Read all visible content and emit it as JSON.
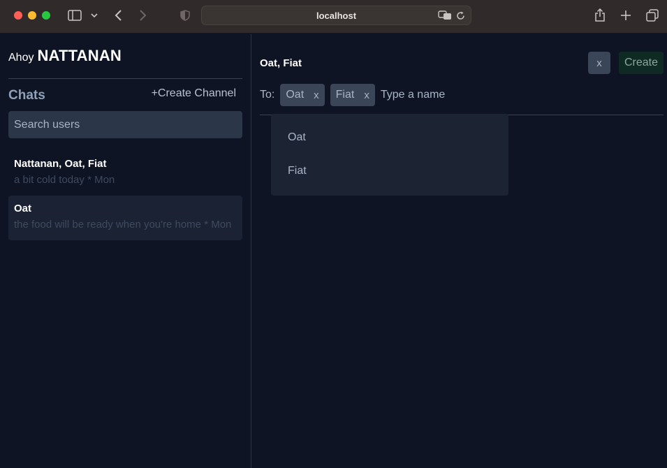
{
  "browser": {
    "url": "localhost"
  },
  "sidebar": {
    "greeting_prefix": "Ahoy",
    "username": "NATTANAN",
    "chats_title": "Chats",
    "create_channel_label": "+Create Channel",
    "search_placeholder": "Search users",
    "chats": [
      {
        "name": "Nattanan, Oat, Fiat",
        "preview": "a bit cold today * Mon"
      },
      {
        "name": "Oat",
        "preview": "the food will be ready when you're home * Mon"
      }
    ]
  },
  "main": {
    "title": "Oat, Fiat",
    "close_label": "x",
    "create_label": "Create",
    "to_label": "To:",
    "recipients": [
      {
        "name": "Oat",
        "remove_label": "x"
      },
      {
        "name": "Fiat",
        "remove_label": "x"
      }
    ],
    "name_placeholder": "Type a name",
    "suggestions": [
      "Oat",
      "Fiat"
    ]
  }
}
